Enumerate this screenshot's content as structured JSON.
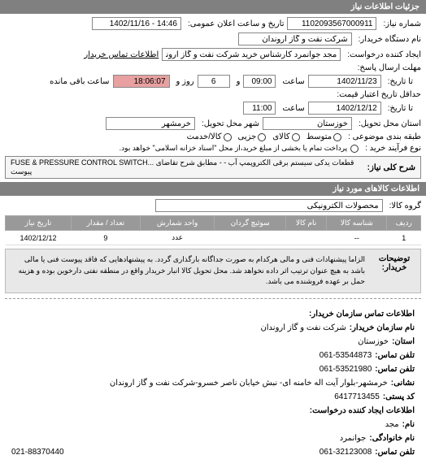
{
  "header": {
    "title": "جزئیات اطلاعات نیاز"
  },
  "form": {
    "req_no_label": "شماره نیاز:",
    "req_no": "1102093567000911",
    "ann_label": "تاریخ و ساعت اعلان عمومی:",
    "ann_value": "14:46 - 1402/11/16",
    "dev_label": "نام دستگاه خریدار:",
    "dev_value": "شرکت نفت و گاز اروندان",
    "creator_label": "ایجاد کننده درخواست:",
    "creator_value": "مجد جوانمرد کارشناس خرید شرکت نفت و گاز اروندان",
    "creator_contact": "اطلاعات تماس خریدار",
    "deadline_group": "مهلت ارسال پاسخ:",
    "to_date_label": "تا تاریخ:",
    "to_date": "1402/11/23",
    "hour_label": "ساعت",
    "to_hour": "09:00",
    "and_label": "و",
    "days": "6",
    "days_label": "روز و",
    "remain": "18:06:07",
    "remain_label": "ساعت باقی مانده",
    "validity_label": "حداقل تاریخ اعتبار قیمت:",
    "validity_to_label": "تا تاریخ:",
    "validity_to": "1402/12/12",
    "validity_hour": "11:00",
    "location_label": "استان محل تحویل:",
    "province": "خوزستان",
    "city_label": "شهر محل تحویل:",
    "city": "خرمشهر",
    "cat_label": "طبقه بندی موضوعی :",
    "cats": [
      "متوسط",
      "کالای",
      "جزیی",
      "کالا/خدمت"
    ],
    "process_label": "نوع فرآیند خرید :",
    "process_note": "پرداخت تمام یا بخشی از مبلغ خرید،از محل \"اسناد خزانه اسلامی\" خواهد بود.",
    "keyword_label": "شرح کلی نیاز:",
    "keyword_value": "FUSE & PRESSURE CONTROL SWITCH... قطعات یدکی سیستم برقی الکتروپمپ آب - - مطابق شرح تقاضای پیوست"
  },
  "items_section": {
    "title": "اطلاعات کالاهای مورد نیاز",
    "group_label": "گروه کالا:",
    "group_value": "محصولات الکترونیکی",
    "columns": {
      "row": "ردیف",
      "code": "شناسه کالا",
      "name": "نام کالا",
      "spin_unit": "سوئیچ گردان",
      "unit": "واحد شمارش",
      "qty": "تعداد / مقدار",
      "need_date": "تاریخ نیاز"
    },
    "rows": [
      {
        "row": "1",
        "code": "--",
        "name": "",
        "spin_unit": "",
        "unit": "عدد",
        "qty": "9",
        "need_date": "1402/12/12"
      }
    ],
    "buyer_desc_label": "توضیحات خریدار:",
    "buyer_desc": "الزاما پیشنهادات فنی و مالی هرکدام به صورت جداگانه بارگذاری گردد. به پیشنهادهایی که فاقد پیوست فنی یا مالی باشد به هیچ عنوان ترتیب اثر داده نخواهد شد. محل تحویل کالا انبار خریدار واقع در منطقه نفتی دارخوین بوده و هزینه حمل بر عهده فروشنده می باشد."
  },
  "contact": {
    "title": "اطلاعات تماس سازمان خریدار:",
    "org_label": "نام سازمان خریدار:",
    "org": "شرکت نفت و گاز اروندان",
    "province_label": "استان:",
    "province": "خوزستان",
    "phone_label": "تلفن تماس:",
    "phone": "061-53544873",
    "fax_label": "تلفن تماس:",
    "fax": "061-53521980",
    "addr_label": "نشانی:",
    "addr": "خرمشهر-بلوار آیت اله خامنه ای- نبش خیابان ناصر خسرو-شرکت نفت و گاز اروندان",
    "post_label": "کد پستی:",
    "post": "6417713455",
    "creator_title": "اطلاعات ایجاد کننده درخواست:",
    "name_label": "نام:",
    "name": "مجد",
    "family_label": "نام خانوادگی:",
    "family": "جوانمرد",
    "cphone_label": "تلفن تماس:",
    "cphone1": "061-32123008",
    "cphone2": "021-88370440"
  }
}
